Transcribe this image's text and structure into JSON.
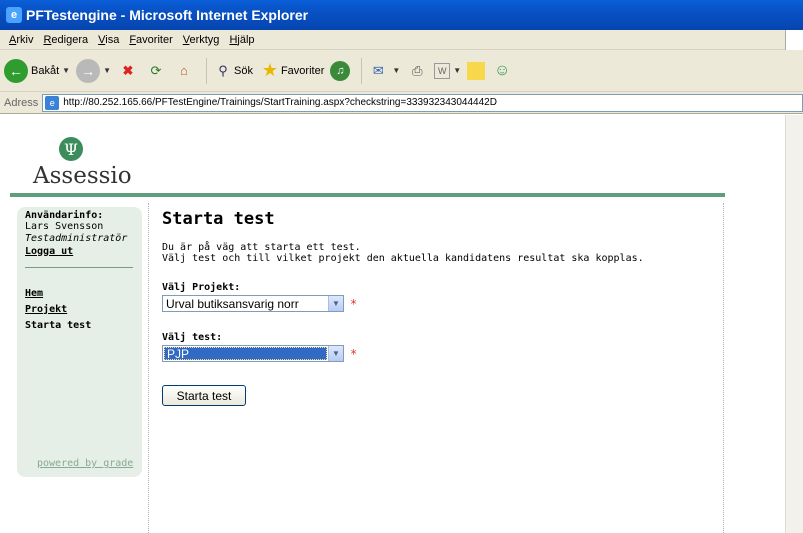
{
  "window": {
    "title": "PFTestengine - Microsoft Internet Explorer"
  },
  "menu": [
    "Arkiv",
    "Redigera",
    "Visa",
    "Favoriter",
    "Verktyg",
    "Hjälp"
  ],
  "toolbar": {
    "back_label": "Bakåt",
    "search_label": "Sök",
    "favorites_label": "Favoriter"
  },
  "address": {
    "label": "Adress",
    "url": "http://80.252.165.66/PFTestEngine/Trainings/StartTraining.aspx?checkstring=333932343044442D"
  },
  "logo": {
    "text": "Assessio",
    "symbol": "Ψ"
  },
  "sidebar": {
    "heading": "Användarinfo:",
    "user_name": "Lars Svensson",
    "user_role": "Testadministratör",
    "logout": "Logga ut",
    "nav": [
      {
        "label": "Hem"
      },
      {
        "label": "Projekt"
      }
    ],
    "nav_active": "Starta test",
    "powered_by": "powered by grade"
  },
  "main": {
    "title": "Starta test",
    "intro_line1": "Du är på väg att starta ett test.",
    "intro_line2": "Välj test och till vilket projekt den aktuella kandidatens resultat ska kopplas.",
    "project_label": "Välj Projekt:",
    "project_value": "Urval butiksansvarig norr",
    "test_label": "Välj test:",
    "test_value": "PJP",
    "required_mark": "*",
    "start_button": "Starta test"
  }
}
